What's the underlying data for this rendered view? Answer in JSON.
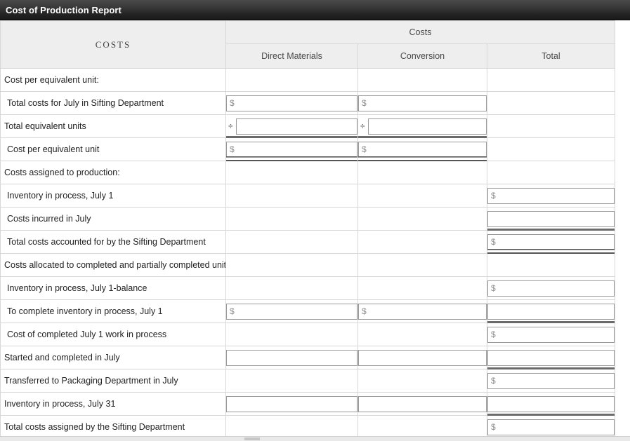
{
  "window": {
    "title": "Cost of Production Report"
  },
  "table": {
    "row_label_header": "COSTS",
    "group_header": "Costs",
    "columns": [
      {
        "key": "direct_materials",
        "label": "Direct Materials"
      },
      {
        "key": "conversion",
        "label": "Conversion"
      },
      {
        "key": "total",
        "label": "Total"
      }
    ],
    "money_placeholder": "$",
    "blank_placeholder": "",
    "divide_operator": "÷",
    "rows": [
      {
        "label": "Cost per equivalent unit:",
        "indent": 0,
        "direct_materials": {
          "type": "none"
        },
        "conversion": {
          "type": "none"
        },
        "total": {
          "type": "none"
        }
      },
      {
        "label": "Total costs for July in Sifting Department",
        "indent": 1,
        "direct_materials": {
          "type": "input",
          "value": "",
          "placeholder": "$"
        },
        "conversion": {
          "type": "input",
          "value": "",
          "placeholder": "$"
        },
        "total": {
          "type": "none"
        }
      },
      {
        "label": "Total equivalent units",
        "indent": 0,
        "direct_materials": {
          "type": "input",
          "value": "",
          "placeholder": "",
          "operator": "÷",
          "rule_bottom": "thick"
        },
        "conversion": {
          "type": "input",
          "value": "",
          "placeholder": "",
          "operator": "÷",
          "rule_bottom": "thick"
        },
        "total": {
          "type": "none"
        }
      },
      {
        "label": "Cost per equivalent unit",
        "indent": 1,
        "direct_materials": {
          "type": "input",
          "value": "",
          "placeholder": "$",
          "rule_bottom": "double"
        },
        "conversion": {
          "type": "input",
          "value": "",
          "placeholder": "$",
          "rule_bottom": "double"
        },
        "total": {
          "type": "none"
        }
      },
      {
        "label": "Costs assigned to production:",
        "indent": 0,
        "direct_materials": {
          "type": "none"
        },
        "conversion": {
          "type": "none"
        },
        "total": {
          "type": "none"
        }
      },
      {
        "label": "Inventory in process, July 1",
        "indent": 1,
        "direct_materials": {
          "type": "none"
        },
        "conversion": {
          "type": "none"
        },
        "total": {
          "type": "input",
          "value": "",
          "placeholder": "$"
        }
      },
      {
        "label": "Costs incurred in July",
        "indent": 1,
        "direct_materials": {
          "type": "none"
        },
        "conversion": {
          "type": "none"
        },
        "total": {
          "type": "input",
          "value": "",
          "placeholder": "",
          "rule_bottom": "thick"
        }
      },
      {
        "label": "Total costs accounted for by the Sifting Department",
        "indent": 1,
        "direct_materials": {
          "type": "none"
        },
        "conversion": {
          "type": "none"
        },
        "total": {
          "type": "input",
          "value": "",
          "placeholder": "$",
          "rule_bottom": "double"
        }
      },
      {
        "label": "Costs allocated to completed and partially completed units:",
        "indent": 0,
        "direct_materials": {
          "type": "none"
        },
        "conversion": {
          "type": "none"
        },
        "total": {
          "type": "none"
        }
      },
      {
        "label": "Inventory in process, July 1-balance",
        "indent": 1,
        "direct_materials": {
          "type": "none"
        },
        "conversion": {
          "type": "none"
        },
        "total": {
          "type": "input",
          "value": "",
          "placeholder": "$"
        }
      },
      {
        "label": "To complete inventory in process, July 1",
        "indent": 1,
        "direct_materials": {
          "type": "input",
          "value": "",
          "placeholder": "$"
        },
        "conversion": {
          "type": "input",
          "value": "",
          "placeholder": "$"
        },
        "total": {
          "type": "input",
          "value": "",
          "placeholder": "",
          "rule_bottom": "thick"
        }
      },
      {
        "label": "Cost of completed July 1 work in process",
        "indent": 1,
        "direct_materials": {
          "type": "none"
        },
        "conversion": {
          "type": "none"
        },
        "total": {
          "type": "input",
          "value": "",
          "placeholder": "$"
        }
      },
      {
        "label": "Started and completed in July",
        "indent": 0,
        "direct_materials": {
          "type": "input",
          "value": "",
          "placeholder": ""
        },
        "conversion": {
          "type": "input",
          "value": "",
          "placeholder": ""
        },
        "total": {
          "type": "input",
          "value": "",
          "placeholder": "",
          "rule_bottom": "thick"
        }
      },
      {
        "label": "Transferred to Packaging Department in July",
        "indent": 0,
        "direct_materials": {
          "type": "none"
        },
        "conversion": {
          "type": "none"
        },
        "total": {
          "type": "input",
          "value": "",
          "placeholder": "$"
        }
      },
      {
        "label": "Inventory in process, July 31",
        "indent": 0,
        "direct_materials": {
          "type": "input",
          "value": "",
          "placeholder": ""
        },
        "conversion": {
          "type": "input",
          "value": "",
          "placeholder": ""
        },
        "total": {
          "type": "input",
          "value": "",
          "placeholder": "",
          "rule_bottom": "thick"
        }
      },
      {
        "label": "Total costs assigned by the Sifting Department",
        "indent": 0,
        "direct_materials": {
          "type": "none"
        },
        "conversion": {
          "type": "none"
        },
        "total": {
          "type": "input",
          "value": "",
          "placeholder": "$"
        }
      }
    ]
  },
  "colors": {
    "titlebar": "#2a2a2a",
    "header_bg": "#eeeeee",
    "grid_line": "#d7d7d7",
    "rule": "#6b6b6b",
    "input_border": "#999999",
    "label_text": "#222222",
    "header_text": "#4a4a4a"
  }
}
